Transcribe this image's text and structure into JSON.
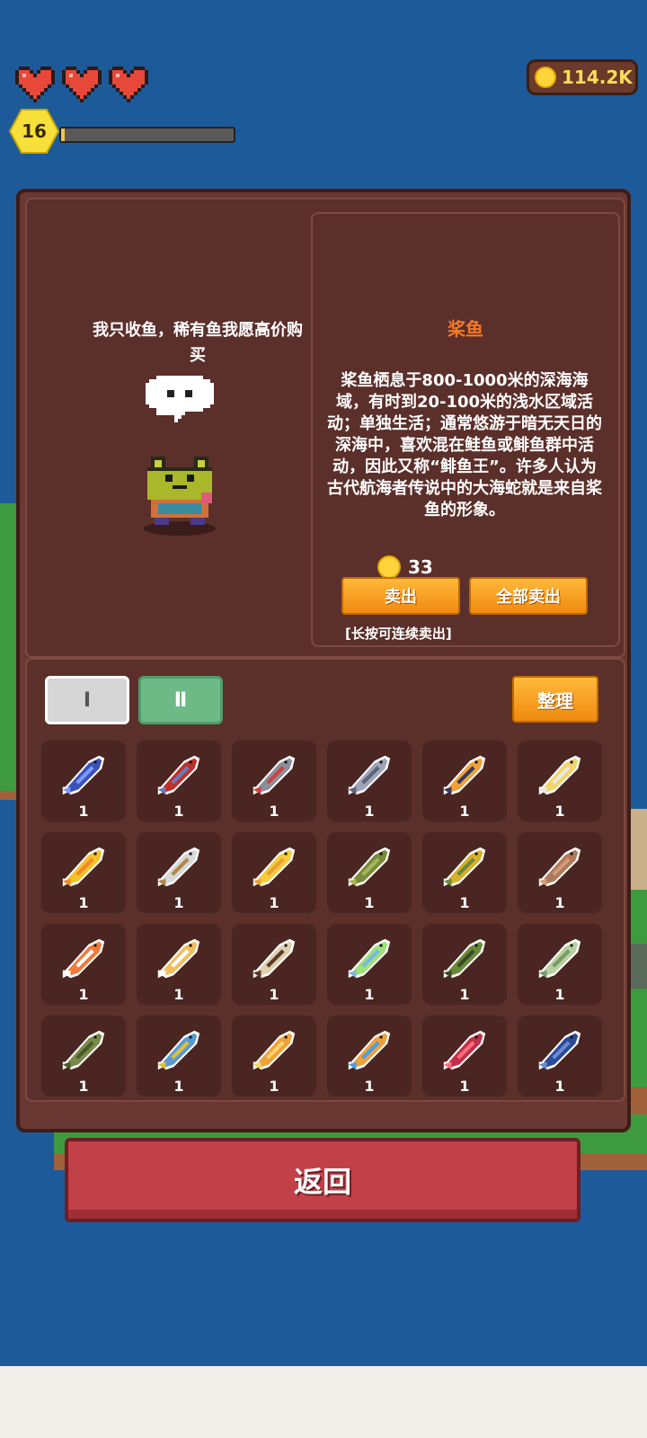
{
  "hud": {
    "hearts": [
      "heart",
      "heart",
      "heart"
    ],
    "level": "16",
    "xp_fraction": 0.02,
    "coins": "114.2K"
  },
  "npc": {
    "speech": "我只收鱼，稀有鱼我愿高价购买"
  },
  "detail": {
    "name": "桨鱼",
    "description": "桨鱼栖息于800-1000米的深海海域，有时到20-100米的浅水区域活动；单独生活；通常悠游于暗无天日的深海中，喜欢混在鲑鱼或鲱鱼群中活动，因此又称“鲱鱼王”。许多人认为古代航海者传说中的大海蛇就是来自桨鱼的形象。",
    "price": "33",
    "sell_label": "卖出",
    "sell_all_label": "全部卖出",
    "hint": "[长按可连续卖出]"
  },
  "inventory": {
    "tabs": [
      {
        "label": "Ⅰ",
        "active": false
      },
      {
        "label": "Ⅱ",
        "active": true
      }
    ],
    "sort_label": "整理",
    "slots": [
      {
        "icon": "fish-blue-icon",
        "qty": "1",
        "body": "#3a52b8",
        "accent": "#7a9aff"
      },
      {
        "icon": "fish-red-icon",
        "qty": "1",
        "body": "#c0302a",
        "accent": "#6b7ab8"
      },
      {
        "icon": "fish-gray-red-icon",
        "qty": "1",
        "body": "#8a8f9a",
        "accent": "#d04040"
      },
      {
        "icon": "fish-silver-icon",
        "qty": "1",
        "body": "#a0a4b8",
        "accent": "#606478"
      },
      {
        "icon": "fish-orange-icon",
        "qty": "1",
        "body": "#f2a23a",
        "accent": "#3a3a5a"
      },
      {
        "icon": "fish-gold-icon",
        "qty": "1",
        "body": "#f3d46a",
        "accent": "#e8e8e8"
      },
      {
        "icon": "fish-yellow-icon",
        "qty": "1",
        "body": "#f5c12a",
        "accent": "#f08a2a"
      },
      {
        "icon": "fish-white-icon",
        "qty": "1",
        "body": "#d8d8d8",
        "accent": "#b08a4a"
      },
      {
        "icon": "fish-golden-icon",
        "qty": "1",
        "body": "#f7cd3a",
        "accent": "#e8a23a"
      },
      {
        "icon": "fish-green-icon",
        "qty": "1",
        "body": "#7a8a3a",
        "accent": "#a6b65a"
      },
      {
        "icon": "fish-yellow-green-icon",
        "qty": "1",
        "body": "#d8b02a",
        "accent": "#6a8a3a"
      },
      {
        "icon": "fish-brown-icon",
        "qty": "1",
        "body": "#b07a5a",
        "accent": "#d09a7a"
      },
      {
        "icon": "fish-clown-icon",
        "qty": "1",
        "body": "#f07a3a",
        "accent": "#ffffff"
      },
      {
        "icon": "fish-pale-yellow-icon",
        "qty": "1",
        "body": "#f0c060",
        "accent": "#ffffff"
      },
      {
        "icon": "fish-striped-icon",
        "qty": "1",
        "body": "#e0d0b0",
        "accent": "#5a3a2a"
      },
      {
        "icon": "fish-lime-icon",
        "qty": "1",
        "body": "#9ee07a",
        "accent": "#7ab8e0"
      },
      {
        "icon": "fish-olive-icon",
        "qty": "1",
        "body": "#6a8a3a",
        "accent": "#3a4a2a"
      },
      {
        "icon": "fish-pale-green-icon",
        "qty": "1",
        "body": "#b8d0a0",
        "accent": "#7a9a6a"
      },
      {
        "icon": "fish-bass-icon",
        "qty": "1",
        "body": "#7a8a4a",
        "accent": "#4a5a2a"
      },
      {
        "icon": "fish-rainbow-icon",
        "qty": "1",
        "body": "#5a9ad0",
        "accent": "#e0c03a"
      },
      {
        "icon": "fish-puffer-icon",
        "qty": "1",
        "body": "#f0a23a",
        "accent": "#f5d46a"
      },
      {
        "icon": "fish-sky-icon",
        "qty": "1",
        "body": "#f0a03a",
        "accent": "#4aa0e0"
      },
      {
        "icon": "fish-shrimp-icon",
        "qty": "1",
        "body": "#c0304a",
        "accent": "#ff6a7a"
      },
      {
        "icon": "fish-navy-icon",
        "qty": "1",
        "body": "#2a4a9a",
        "accent": "#6a8ad0"
      }
    ]
  },
  "back_label": "返回"
}
